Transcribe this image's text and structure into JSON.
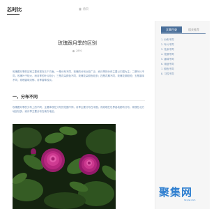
{
  "header": {
    "logo": "芯时比",
    "nav_home": "首页"
  },
  "article": {
    "title": "玫瑰跟月季的区别",
    "meta": "2891",
    "intro": "玫瑰跟月季的区别主要体现在五个方面，一是分布不同，玫瑰的分布比较广泛，而月季的分布主要以中国为主；二是叶片不同，玫瑰叶子较大，而月季的叶片较小；三是花朵颜色不同，玫瑰花朵颜色较多；四是花期不同，玫瑰花期较短；五是香味不同，玫瑰香味浓郁，月季香味较淡。",
    "section_heading": "一，分布不同",
    "section_text": "玫瑰跟月季的分布上的不同，主要体现在分布的范围不同，月季主要分布在中国，而玫瑰在世界各地都有分布，玫瑰在北方地区较多，而月季主要分布在南方地区。"
  },
  "sidebar": {
    "tabs": [
      "文章目录",
      "相关推荐"
    ],
    "toc": [
      "1. 分布不同",
      "2. 叶片不同",
      "3. 花朵不同",
      "4. 花期不同",
      "5. 香味不同",
      "6. 用途不同",
      "7. 颜色不同",
      "8. 习性不同"
    ]
  },
  "watermark": {
    "text": "聚集网",
    "sub": "hz.jzw.com"
  }
}
